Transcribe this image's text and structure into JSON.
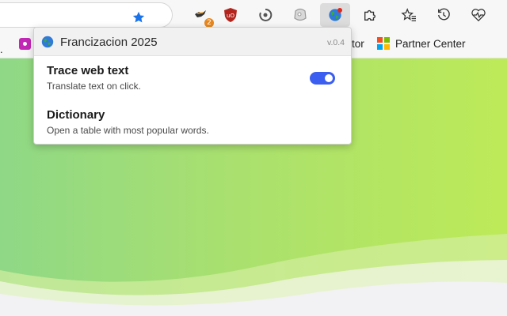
{
  "toolbar": {
    "bookmark_star": "bookmark-star",
    "extensions": [
      {
        "name": "ninja-extension-icon",
        "badge": "2"
      },
      {
        "name": "ublock-icon",
        "label": "uO"
      },
      {
        "name": "refresh-extension-icon"
      },
      {
        "name": "ghost-extension-icon"
      },
      {
        "name": "globe-extension-icon",
        "active": true
      },
      {
        "name": "puzzle-icon"
      },
      {
        "name": "favorites-icon"
      },
      {
        "name": "history-icon"
      },
      {
        "name": "heartbeat-icon"
      }
    ]
  },
  "bookmarks": {
    "partial_left": ".",
    "partial_tor": "tor",
    "partner_center": "Partner Center"
  },
  "popup": {
    "title": "Francizacion 2025",
    "version": "v.0.4",
    "options": [
      {
        "title": "Trace web text",
        "description": "Translate text on click.",
        "toggle": true
      },
      {
        "title": "Dictionary",
        "description": "Open a table with most popular words."
      }
    ]
  },
  "colors": {
    "accent": "#3b5ef0",
    "star": "#1a73e8",
    "badge": "#e8871e",
    "ublock": "#b3241d",
    "gradient_left": "#8fd886",
    "gradient_right": "#bdea58"
  }
}
